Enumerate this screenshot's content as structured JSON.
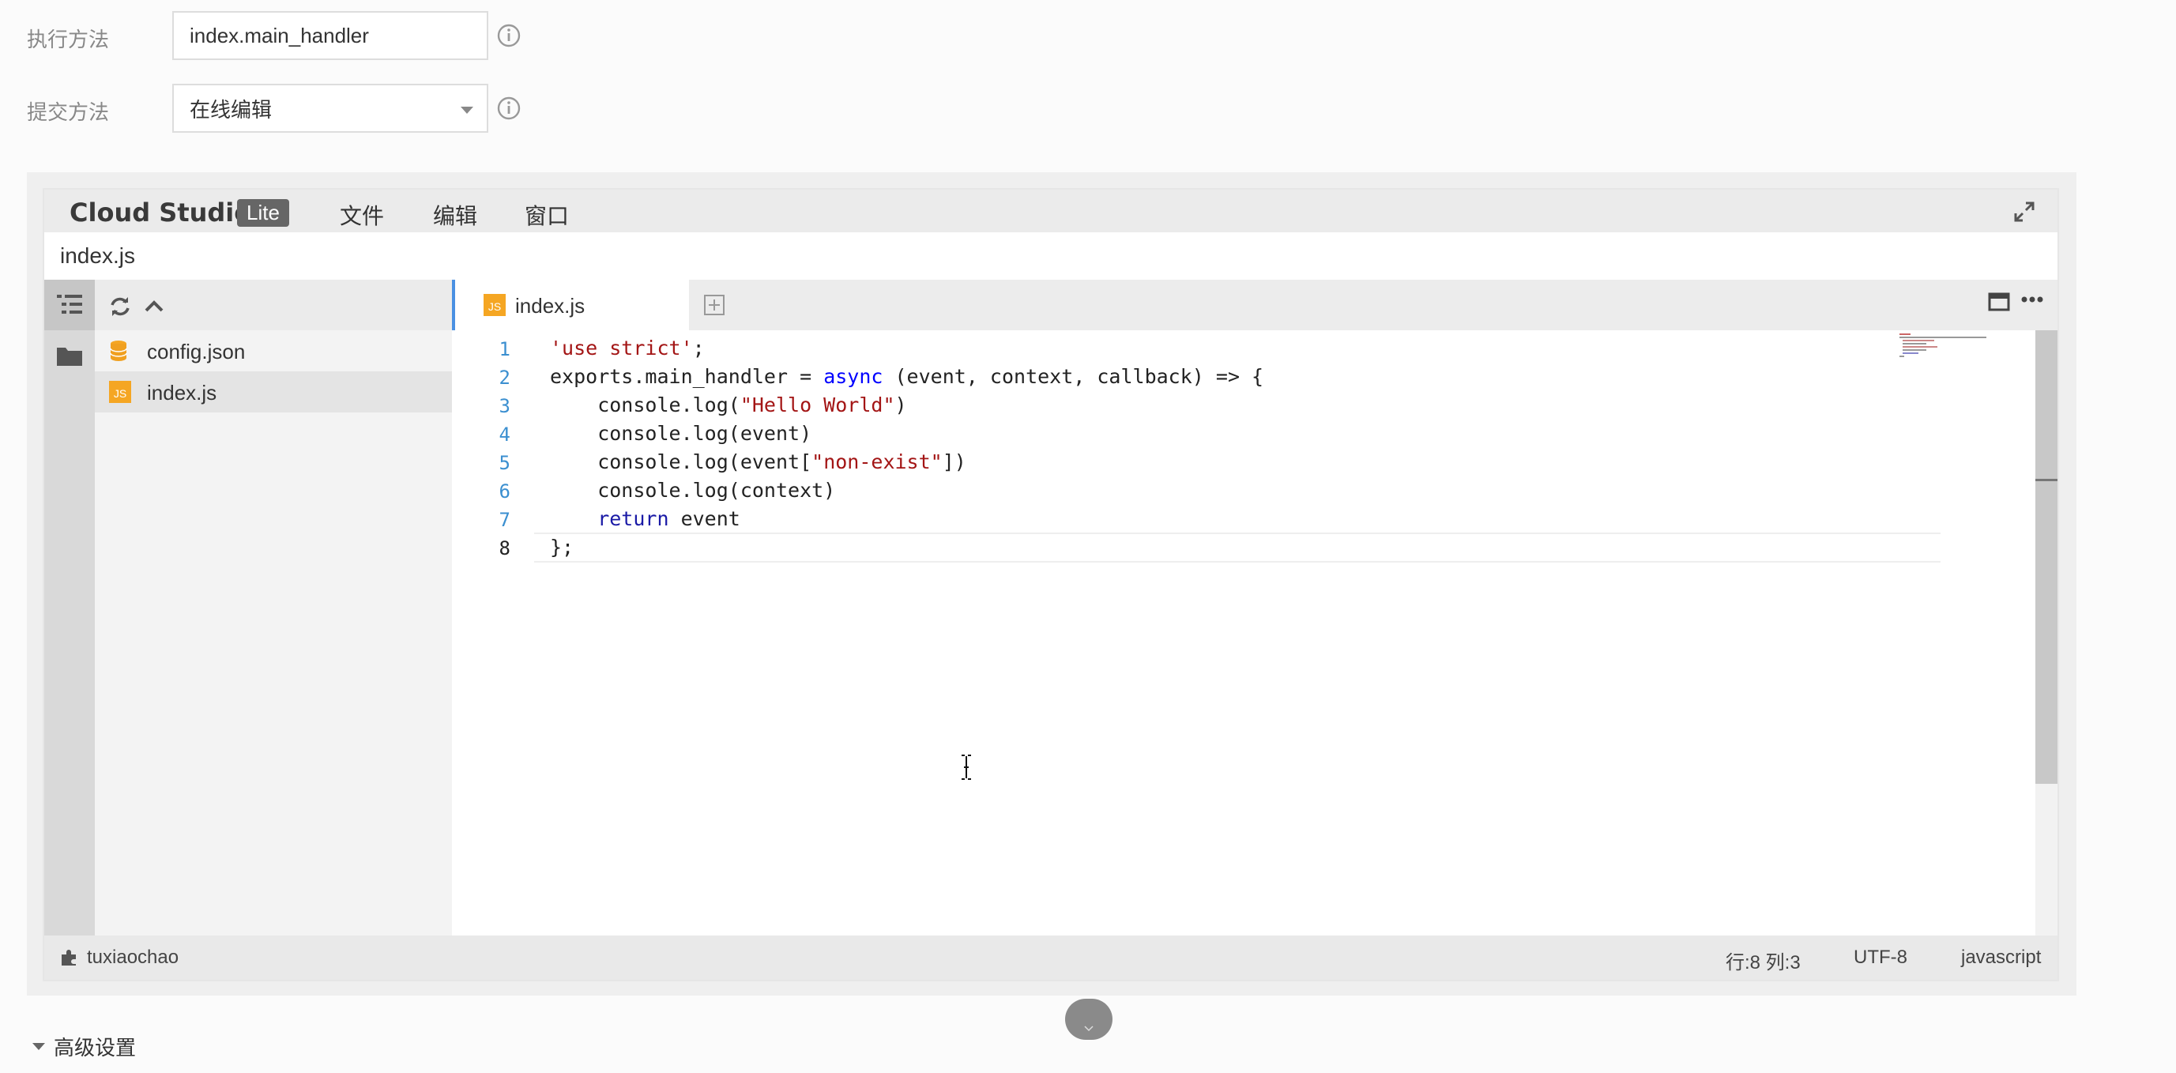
{
  "form": {
    "exec_label": "执行方法",
    "exec_value": "index.main_handler",
    "submit_label": "提交方法",
    "submit_value": "在线编辑",
    "advanced_label": "高级设置"
  },
  "ide": {
    "brand": "Cloud Studio",
    "edition": "Lite",
    "menu": [
      "文件",
      "编辑",
      "窗口"
    ],
    "path": "index.js",
    "files": [
      {
        "name": "config.json",
        "icon": "json-file-icon"
      },
      {
        "name": "index.js",
        "icon": "js-file-icon"
      }
    ],
    "tab": {
      "label": "index.js",
      "badge": "JS"
    },
    "line_numbers": [
      "1",
      "2",
      "3",
      "4",
      "5",
      "6",
      "7",
      "8"
    ],
    "code": {
      "l1_str": "'use strict'",
      "l1_end": ";",
      "l2_a": "exports.main_handler = ",
      "l2_kw": "async",
      "l2_b": " (event, context, callback) => {",
      "l3_a": "    console.log(",
      "l3_str": "\"Hello World\"",
      "l3_b": ")",
      "l4": "    console.log(event)",
      "l5_a": "    console.log(event[",
      "l5_str": "\"non-exist\"",
      "l5_b": "])",
      "l6": "    console.log(context)",
      "l7_kw": "    return",
      "l7_b": " event",
      "l8": "};"
    },
    "status": {
      "user": "tuxiaochao",
      "position": "行:8 列:3",
      "encoding": "UTF-8",
      "language": "javascript"
    }
  },
  "colors": {
    "accent": "#4a90e2",
    "string": "#a31515",
    "keyword": "#0000ff",
    "js_badge": "#f5a623"
  }
}
